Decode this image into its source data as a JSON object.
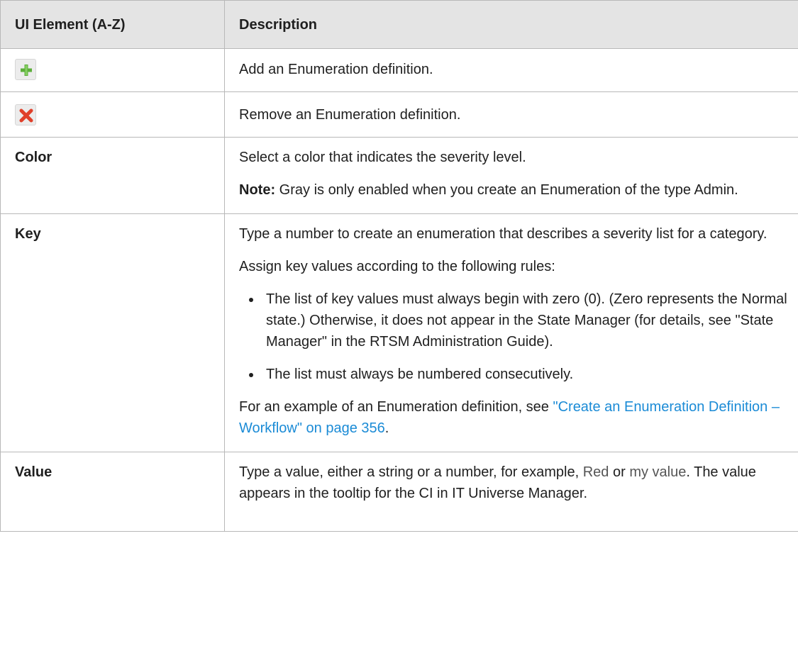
{
  "table": {
    "headers": [
      "UI Element (A-Z)",
      "Description"
    ],
    "rows": {
      "add": {
        "icon": "add-plus-icon",
        "description": "Add an Enumeration definition."
      },
      "remove": {
        "icon": "remove-x-icon",
        "description": "Remove an Enumeration definition."
      },
      "color": {
        "element": "Color",
        "description": "Select a color that indicates the severity level.",
        "note_label": "Note:",
        "note_text": " Gray is only enabled when you create an Enumeration of the type Admin."
      },
      "key": {
        "element": "Key",
        "p1": "Type a number to create an enumeration that describes a severity list for a category.",
        "p2": "Assign key values according to the following rules:",
        "bullets": [
          "The list of key values must always begin with zero (0). (Zero represents the Normal state.) Otherwise, it does not appear in the State Manager (for details, see \"State Manager\" in the RTSM Administration Guide).",
          "The list must always be numbered consecutively."
        ],
        "example_prefix": "For an example of an Enumeration definition, see ",
        "example_link": "\"Create an Enumeration Definition – Workflow\" on page 356",
        "example_suffix": "."
      },
      "value": {
        "element": "Value",
        "text1": "Type a value, either a string or a number, for example, ",
        "code1": "Red",
        "text2": " or ",
        "code2": "my value",
        "text3": ". The value appears in the tooltip for the CI in IT Universe Manager."
      }
    }
  },
  "colors": {
    "header_bg": "#e4e4e4",
    "border": "#b8b8b8",
    "link": "#1b8bd6",
    "plus_icon": "#5cae3a",
    "remove_icon": "#e0402a"
  }
}
